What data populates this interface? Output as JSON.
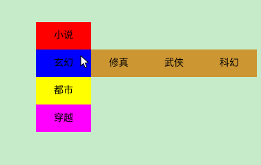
{
  "menu": {
    "items": [
      {
        "label": "小说",
        "color": "#ff0000"
      },
      {
        "label": "玄幻",
        "color": "#0000ff"
      },
      {
        "label": "都市",
        "color": "#ffff00"
      },
      {
        "label": "穿越",
        "color": "#ff00ff"
      }
    ],
    "submenu": {
      "items": [
        "修真",
        "武侠",
        "科幻"
      ],
      "color": "#cc9633"
    }
  },
  "background_color": "#c6ebc9",
  "cursor_icon": "mouse-pointer-icon"
}
